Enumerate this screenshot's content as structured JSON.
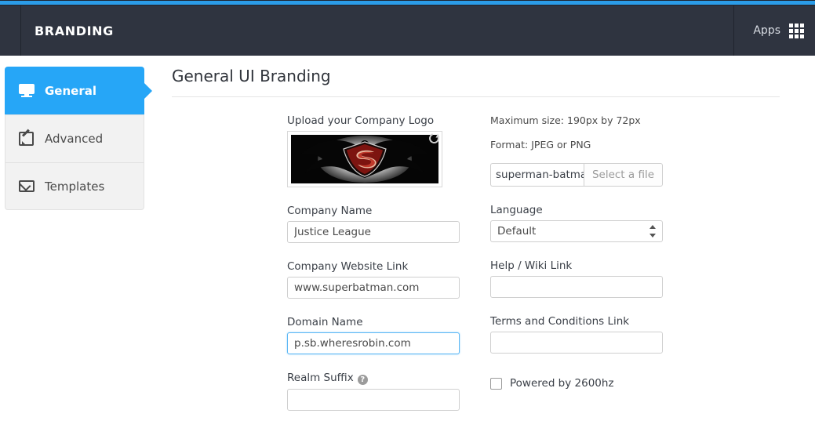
{
  "header": {
    "brand_title": "BRANDING",
    "apps_label": "Apps",
    "apps_icon": "grid-icon",
    "background_color": "#2f3440",
    "accent_strip_color": "#2b9ce8"
  },
  "sidebar": {
    "active_color": "#26a6f7",
    "items": [
      {
        "label": "General",
        "icon": "monitor-icon",
        "active": true
      },
      {
        "label": "Advanced",
        "icon": "edit-square-icon",
        "active": false
      },
      {
        "label": "Templates",
        "icon": "envelope-icon",
        "active": false
      }
    ]
  },
  "main": {
    "page_title": "General UI Branding",
    "logo": {
      "label": "Upload your Company Logo",
      "preview_alt": "superman-batman logo",
      "reload_icon": "refresh-icon",
      "max_size_text": "Maximum size: 190px by 72px",
      "format_text": "Format: JPEG or PNG",
      "file_name": "superman-batman-j",
      "file_button": "Select a file"
    },
    "fields": {
      "company_name": {
        "label": "Company Name",
        "value": "Justice League",
        "placeholder": ""
      },
      "company_website": {
        "label": "Company Website Link",
        "value": "www.superbatman.com",
        "placeholder": ""
      },
      "domain_name": {
        "label": "Domain Name",
        "value": "p.sb.wheresrobin.com",
        "placeholder": "",
        "focused": true
      },
      "realm_suffix": {
        "label": "Realm Suffix",
        "value": "",
        "placeholder": "",
        "help_icon": "question-mark-icon"
      },
      "language": {
        "label": "Language",
        "value": "Default",
        "options": [
          "Default"
        ]
      },
      "help_wiki": {
        "label": "Help / Wiki Link",
        "value": "",
        "placeholder": ""
      },
      "terms": {
        "label": "Terms and Conditions Link",
        "value": "",
        "placeholder": ""
      },
      "powered_by": {
        "label": "Powered by 2600hz",
        "checked": false
      }
    }
  }
}
